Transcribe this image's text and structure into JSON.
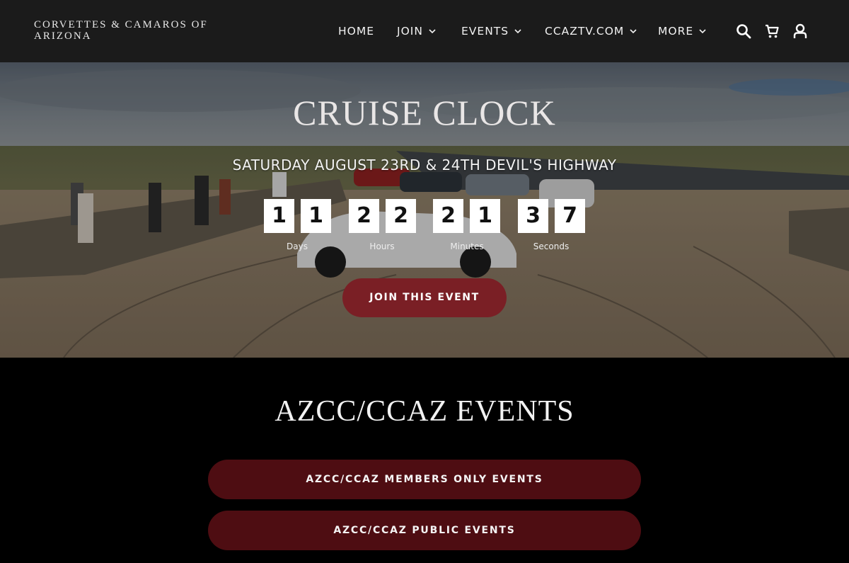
{
  "site": {
    "brand_line1": "CORVETTES & CAMAROS OF",
    "brand_line2": "ARIZONA"
  },
  "nav": {
    "items": [
      {
        "label": "HOME",
        "has_dropdown": false
      },
      {
        "label": "JOIN",
        "has_dropdown": true
      },
      {
        "label": "EVENTS",
        "has_dropdown": true
      },
      {
        "label": "CCAZTV.COM",
        "has_dropdown": true
      },
      {
        "label": "MORE",
        "has_dropdown": true
      }
    ],
    "icons": [
      "search-icon",
      "cart-icon",
      "account-icon"
    ]
  },
  "hero": {
    "title": "CRUISE CLOCK",
    "subtitle": "SATURDAY AUGUST 23RD & 24TH DEVIL'S HIGHWAY",
    "countdown": {
      "days": [
        "1",
        "1"
      ],
      "hours": [
        "2",
        "2"
      ],
      "minutes": [
        "2",
        "1"
      ],
      "seconds": [
        "3",
        "7"
      ],
      "labels": {
        "days": "Days",
        "hours": "Hours",
        "minutes": "Minutes",
        "seconds": "Seconds"
      }
    },
    "cta_label": "JOIN THIS EVENT"
  },
  "events": {
    "title": "AZCC/CCAZ EVENTS",
    "buttons": [
      {
        "label": "AZCC/CCAZ MEMBERS ONLY EVENTS"
      },
      {
        "label": "AZCC/CCAZ PUBLIC EVENTS"
      }
    ]
  },
  "colors": {
    "header_bg": "#1b1b1b",
    "cta_bg": "#7a1f25",
    "event_button_bg": "#4e0d12",
    "page_bg": "#000000"
  }
}
